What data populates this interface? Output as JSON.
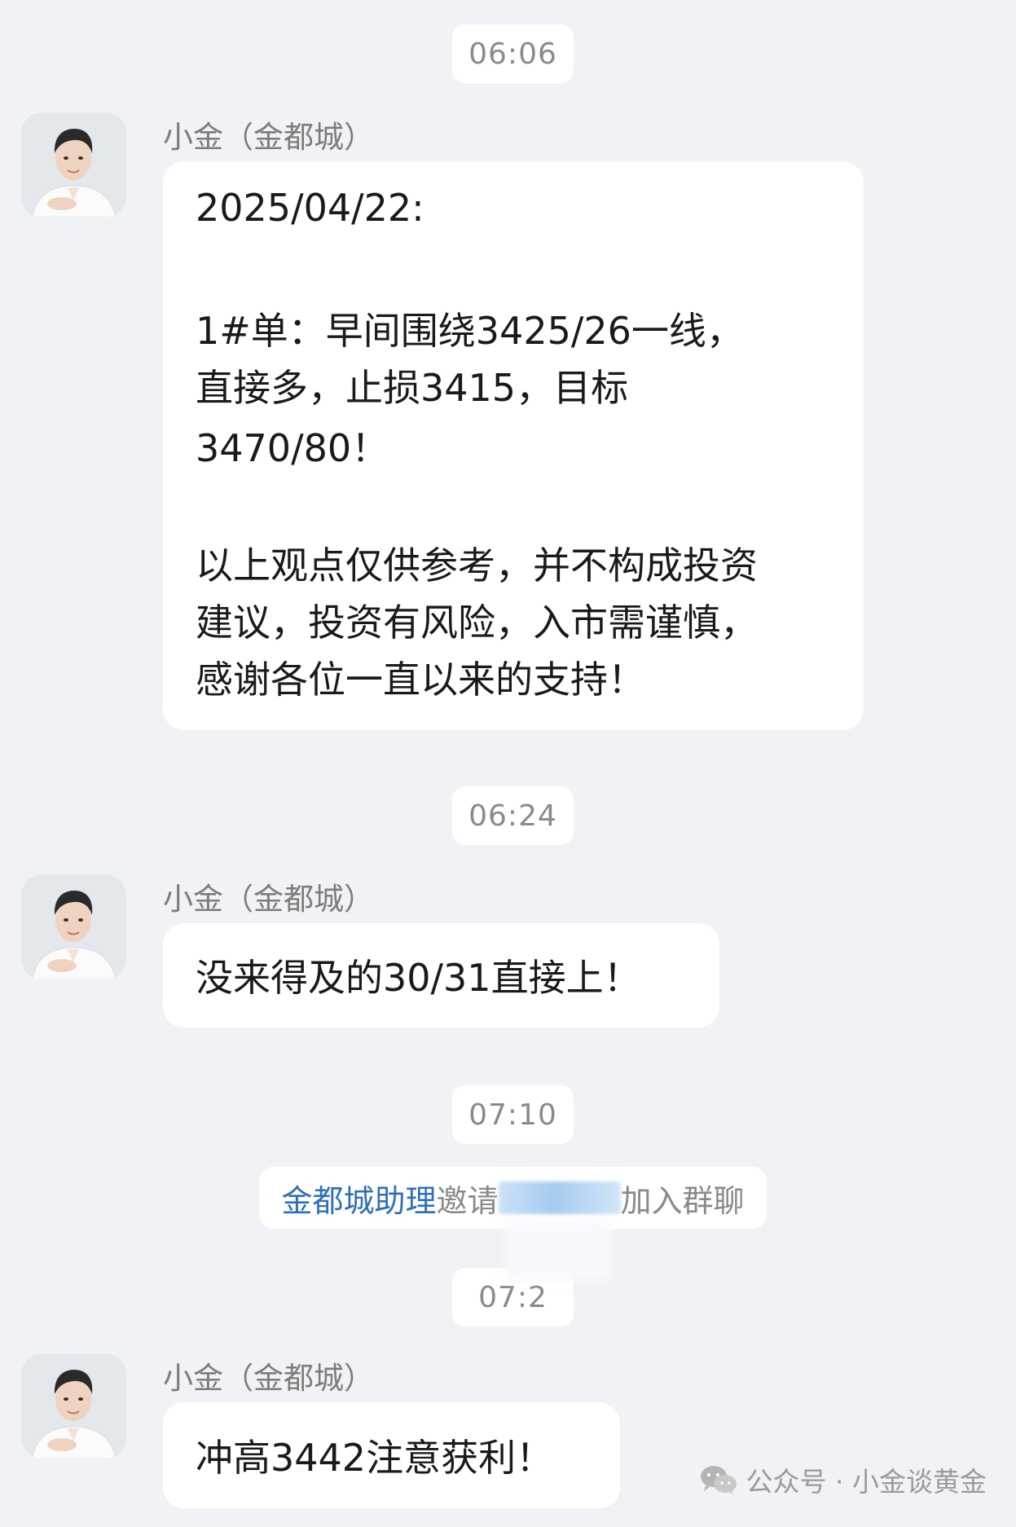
{
  "timestamps": [
    "06:06",
    "06:24",
    "07:10",
    "07:2"
  ],
  "sender_name": "小金（金都城）",
  "messages": [
    {
      "lines": [
        "2025/04/22:",
        "1#单：早间围绕3425/26一线，",
        "直接多，止损3415，目标",
        "3470/80！",
        "以上观点仅供参考，并不构成投资",
        "建议，投资有风险，入市需谨慎，",
        "感谢各位一直以来的支持！"
      ]
    },
    {
      "text": "没来得及的30/31直接上！"
    },
    {
      "text": "冲高3442注意获利！"
    }
  ],
  "system_notice": {
    "actor": "金都城助理",
    "verb": "邀请",
    "suffix": "加入群聊"
  },
  "watermark": "公众号 · 小金谈黄金",
  "colors": {
    "background": "#f1f2f6",
    "bubble": "#ffffff",
    "link": "#2f6fb8",
    "muted": "#8a8a8a"
  },
  "icons": [
    "avatar-photo",
    "wechat-icon"
  ]
}
